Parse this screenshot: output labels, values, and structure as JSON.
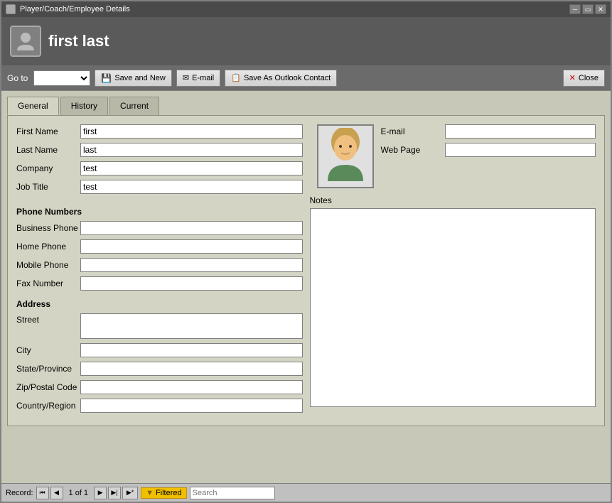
{
  "window": {
    "title": "Player/Coach/Employee Details",
    "controls": [
      "minimize",
      "restore",
      "close"
    ]
  },
  "header": {
    "title": "first last",
    "icon": "person-icon"
  },
  "toolbar": {
    "goto_label": "Go to",
    "goto_options": [
      ""
    ],
    "buttons": {
      "save_new": "Save and New",
      "email": "E-mail",
      "save_outlook": "Save As Outlook Contact",
      "close": "Close"
    }
  },
  "tabs": [
    {
      "id": "general",
      "label": "General",
      "active": true
    },
    {
      "id": "history",
      "label": "History",
      "active": false
    },
    {
      "id": "current",
      "label": "Current",
      "active": false
    }
  ],
  "form": {
    "basic": {
      "first_name_label": "First Name",
      "first_name_value": "first",
      "last_name_label": "Last Name",
      "last_name_value": "last",
      "company_label": "Company",
      "company_value": "test",
      "job_title_label": "Job Title",
      "job_title_value": "test"
    },
    "contact": {
      "email_label": "E-mail",
      "email_value": "",
      "web_page_label": "Web Page",
      "web_page_value": ""
    },
    "phone": {
      "section_title": "Phone Numbers",
      "business_phone_label": "Business Phone",
      "business_phone_value": "",
      "home_phone_label": "Home Phone",
      "home_phone_value": "",
      "mobile_phone_label": "Mobile Phone",
      "mobile_phone_value": "",
      "fax_number_label": "Fax Number",
      "fax_number_value": ""
    },
    "address": {
      "section_title": "Address",
      "street_label": "Street",
      "street_value": "",
      "city_label": "City",
      "city_value": "",
      "state_label": "State/Province",
      "state_value": "",
      "zip_label": "Zip/Postal Code",
      "zip_value": "",
      "country_label": "Country/Region",
      "country_value": ""
    },
    "notes": {
      "label": "Notes",
      "value": ""
    }
  },
  "status_bar": {
    "record_label": "Record:",
    "first_btn": "⏮",
    "prev_btn": "◀",
    "record_position": "1 of 1",
    "next_btn": "▶",
    "last_btn": "⏭",
    "new_btn": "▶|",
    "filtered_label": "Filtered",
    "search_label": "Search",
    "search_placeholder": ""
  }
}
